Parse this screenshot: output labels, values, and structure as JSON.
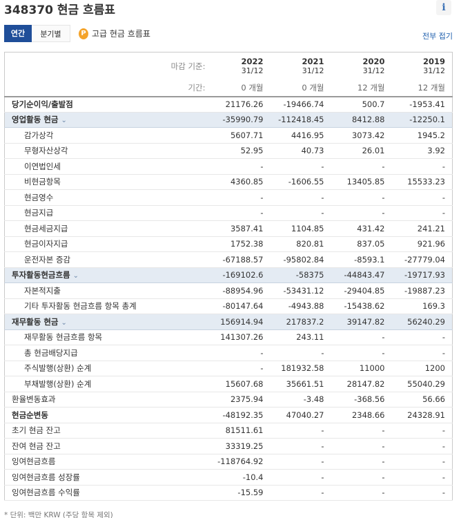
{
  "title": "348370 현금 흐름표",
  "tabs": [
    {
      "label": "연간",
      "active": true
    },
    {
      "label": "분기별",
      "active": false
    }
  ],
  "premium_link": "고급 현금 흐름표",
  "premium_icon": "P",
  "collapse_all": "전부 접기",
  "header": {
    "period_end_label": "마감 기준:",
    "period_length_label": "기간:",
    "columns": [
      {
        "year": "2022",
        "date": "31/12",
        "period": "0 개월"
      },
      {
        "year": "2021",
        "date": "31/12",
        "period": "0 개월"
      },
      {
        "year": "2020",
        "date": "31/12",
        "period": "12 개월"
      },
      {
        "year": "2019",
        "date": "31/12",
        "period": "12 개월"
      }
    ]
  },
  "rows": [
    {
      "label": "당기순이익/출발점",
      "type": "bold",
      "values": [
        "21176.26",
        "-19466.74",
        "500.7",
        "-1953.41"
      ]
    },
    {
      "label": "영업활동 현금",
      "type": "section",
      "values": [
        "-35990.79",
        "-112418.45",
        "8412.88",
        "-12250.1"
      ]
    },
    {
      "label": "감가상각",
      "type": "sub",
      "values": [
        "5607.71",
        "4416.95",
        "3073.42",
        "1945.2"
      ]
    },
    {
      "label": "무형자산상각",
      "type": "sub",
      "values": [
        "52.95",
        "40.73",
        "26.01",
        "3.92"
      ]
    },
    {
      "label": "이연법인세",
      "type": "sub",
      "values": [
        "-",
        "-",
        "-",
        "-"
      ]
    },
    {
      "label": "비현금항목",
      "type": "sub",
      "values": [
        "4360.85",
        "-1606.55",
        "13405.85",
        "15533.23"
      ]
    },
    {
      "label": "현금영수",
      "type": "sub",
      "values": [
        "-",
        "-",
        "-",
        "-"
      ]
    },
    {
      "label": "현금지급",
      "type": "sub",
      "values": [
        "-",
        "-",
        "-",
        "-"
      ]
    },
    {
      "label": "현금세금지급",
      "type": "sub",
      "values": [
        "3587.41",
        "1104.85",
        "431.42",
        "241.21"
      ]
    },
    {
      "label": "현금이자지급",
      "type": "sub",
      "values": [
        "1752.38",
        "820.81",
        "837.05",
        "921.96"
      ]
    },
    {
      "label": "운전자본 증감",
      "type": "sub",
      "values": [
        "-67188.57",
        "-95802.84",
        "-8593.1",
        "-27779.04"
      ]
    },
    {
      "label": "투자활동현금흐름",
      "type": "section",
      "values": [
        "-169102.6",
        "-58375",
        "-44843.47",
        "-19717.93"
      ]
    },
    {
      "label": "자본적지출",
      "type": "sub",
      "values": [
        "-88954.96",
        "-53431.12",
        "-29404.85",
        "-19887.23"
      ]
    },
    {
      "label": "기타 투자활동 현금흐름 항목 총계",
      "type": "sub",
      "values": [
        "-80147.64",
        "-4943.88",
        "-15438.62",
        "169.3"
      ]
    },
    {
      "label": "재무활동 현금",
      "type": "section",
      "values": [
        "156914.94",
        "217837.2",
        "39147.82",
        "56240.29"
      ]
    },
    {
      "label": "재무활동 현금흐름 항목",
      "type": "sub",
      "values": [
        "141307.26",
        "243.11",
        "-",
        "-"
      ]
    },
    {
      "label": "총 현금배당지급",
      "type": "sub",
      "values": [
        "-",
        "-",
        "-",
        "-"
      ]
    },
    {
      "label": "주식발행(상환) 순계",
      "type": "sub",
      "values": [
        "-",
        "181932.58",
        "11000",
        "1200"
      ]
    },
    {
      "label": "부채발행(상환) 순계",
      "type": "sub",
      "values": [
        "15607.68",
        "35661.51",
        "28147.82",
        "55040.29"
      ]
    },
    {
      "label": "환율변동효과",
      "type": "plain",
      "values": [
        "2375.94",
        "-3.48",
        "-368.56",
        "56.66"
      ]
    },
    {
      "label": "현금순변동",
      "type": "bold",
      "values": [
        "-48192.35",
        "47040.27",
        "2348.66",
        "24328.91"
      ]
    },
    {
      "label": "초기 현금 잔고",
      "type": "plain",
      "values": [
        "81511.61",
        "-",
        "-",
        "-"
      ]
    },
    {
      "label": "잔여 현금 잔고",
      "type": "plain",
      "values": [
        "33319.25",
        "-",
        "-",
        "-"
      ]
    },
    {
      "label": "잉여현금흐름",
      "type": "plain",
      "values": [
        "-118764.92",
        "-",
        "-",
        "-"
      ]
    },
    {
      "label": "잉여현금흐름 성장률",
      "type": "plain",
      "values": [
        "-10.4",
        "-",
        "-",
        "-"
      ]
    },
    {
      "label": "잉여현금흐름 수익률",
      "type": "plain",
      "values": [
        "-15.59",
        "-",
        "-",
        "-"
      ]
    }
  ],
  "footnote": "* 단위: 백만 KRW (주당 항목 제외)",
  "colors": {
    "accent": "#1f4e99",
    "section_bg": "#e4ebf3",
    "link": "#1f5fad",
    "premium": "#f4a32a"
  }
}
